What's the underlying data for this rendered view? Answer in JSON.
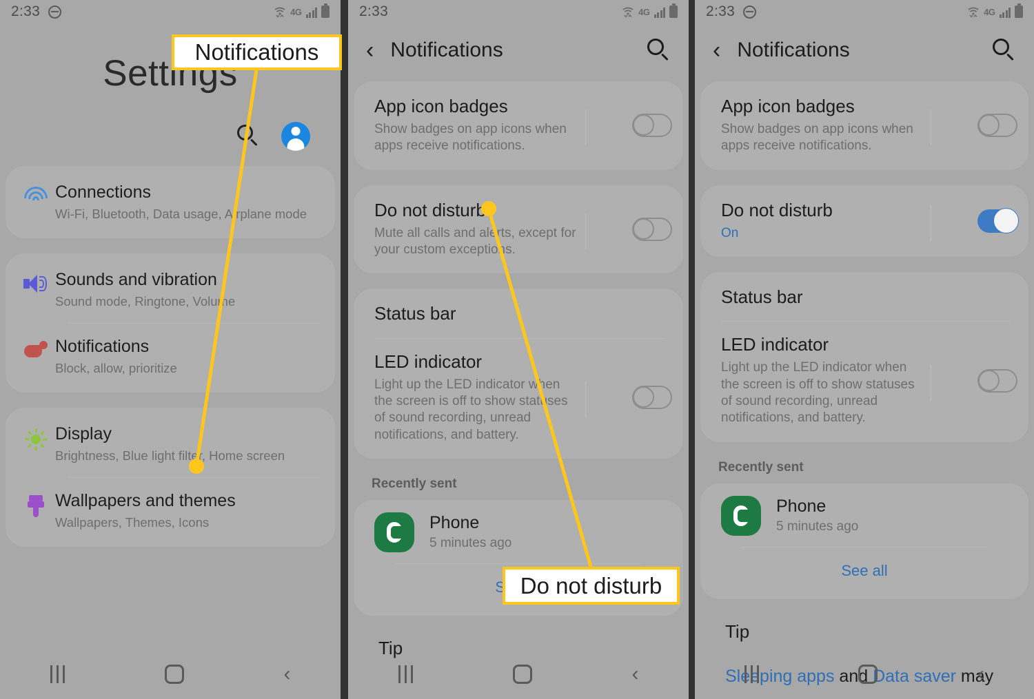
{
  "statusbar": {
    "time": "2:33",
    "dnd_icon": "do-not-disturb-icon",
    "network_label": "4G",
    "icons": [
      "wifi-icon",
      "lte-icon",
      "signal-icon",
      "battery-icon"
    ]
  },
  "colors": {
    "screen_bg": "#a8a8a8",
    "card_bg": "#b0b0b0",
    "accent_blue": "#2e6fb7",
    "toggle_on": "#3d7cc4",
    "callout_border": "#FFC61E",
    "annotation_line": "#FFC61E",
    "divider": "#323232"
  },
  "panel1": {
    "title": "Settings",
    "search_icon": "search-icon",
    "account_icon": "account-avatar-icon",
    "groups": [
      {
        "items": [
          {
            "icon": "wifi-icon",
            "title": "Connections",
            "subtitle": "Wi-Fi, Bluetooth, Data usage, Airplane mode"
          }
        ]
      },
      {
        "items": [
          {
            "icon": "sound-icon",
            "title": "Sounds and vibration",
            "subtitle": "Sound mode, Ringtone, Volume"
          },
          {
            "icon": "notifications-icon",
            "title": "Notifications",
            "subtitle": "Block, allow, prioritize"
          }
        ]
      },
      {
        "items": [
          {
            "icon": "brightness-icon",
            "title": "Display",
            "subtitle": "Brightness, Blue light filter, Home screen"
          },
          {
            "icon": "wallpaper-brush-icon",
            "title": "Wallpapers and themes",
            "subtitle": "Wallpapers, Themes, Icons"
          }
        ]
      }
    ]
  },
  "panel2": {
    "nav": {
      "back_icon": "back-chevron-icon",
      "title": "Notifications",
      "search_icon": "search-icon"
    },
    "rows": [
      {
        "title": "App icon badges",
        "subtitle": "Show badges on app icons when apps receive notifications.",
        "toggle": "off"
      },
      {
        "title": "Do not disturb",
        "subtitle": "Mute all calls and alerts, except for your custom exceptions.",
        "toggle": "off"
      },
      {
        "title": "Status bar",
        "subtitle": "",
        "toggle": "none"
      },
      {
        "title": "LED indicator",
        "subtitle": "Light up the LED indicator when the screen is off to show statuses of sound recording, unread notifications, and battery.",
        "toggle": "off"
      }
    ],
    "recently_sent_label": "Recently sent",
    "app": {
      "icon": "phone-app-icon",
      "name": "Phone",
      "time": "5 minutes ago"
    },
    "see_all": "See all",
    "tip_label": "Tip",
    "tip_body": ""
  },
  "panel3": {
    "nav": {
      "back_icon": "back-chevron-icon",
      "title": "Notifications",
      "search_icon": "search-icon"
    },
    "rows": [
      {
        "title": "App icon badges",
        "subtitle": "Show badges on app icons when apps receive notifications.",
        "toggle": "off"
      },
      {
        "title": "Do not disturb",
        "subtitle": "On",
        "toggle": "on"
      },
      {
        "title": "Status bar",
        "subtitle": "",
        "toggle": "none"
      },
      {
        "title": "LED indicator",
        "subtitle": "Light up the LED indicator when the screen is off to show statuses of sound recording, unread notifications, and battery.",
        "toggle": "off"
      }
    ],
    "recently_sent_label": "Recently sent",
    "app": {
      "icon": "phone-app-icon",
      "name": "Phone",
      "time": "5 minutes ago"
    },
    "see_all": "See all",
    "tip_label": "Tip",
    "tip_link_1": "Sleeping apps",
    "tip_plain_1": " and ",
    "tip_link_2": "Data saver",
    "tip_plain_2": " may"
  },
  "navbar": {
    "recent_icon": "recent-apps-icon",
    "home_icon": "home-icon",
    "back_icon": "back-icon"
  },
  "annotations": [
    {
      "label": "Notifications",
      "name": "callout-notifications"
    },
    {
      "label": "Do not disturb",
      "name": "callout-dnd"
    }
  ]
}
